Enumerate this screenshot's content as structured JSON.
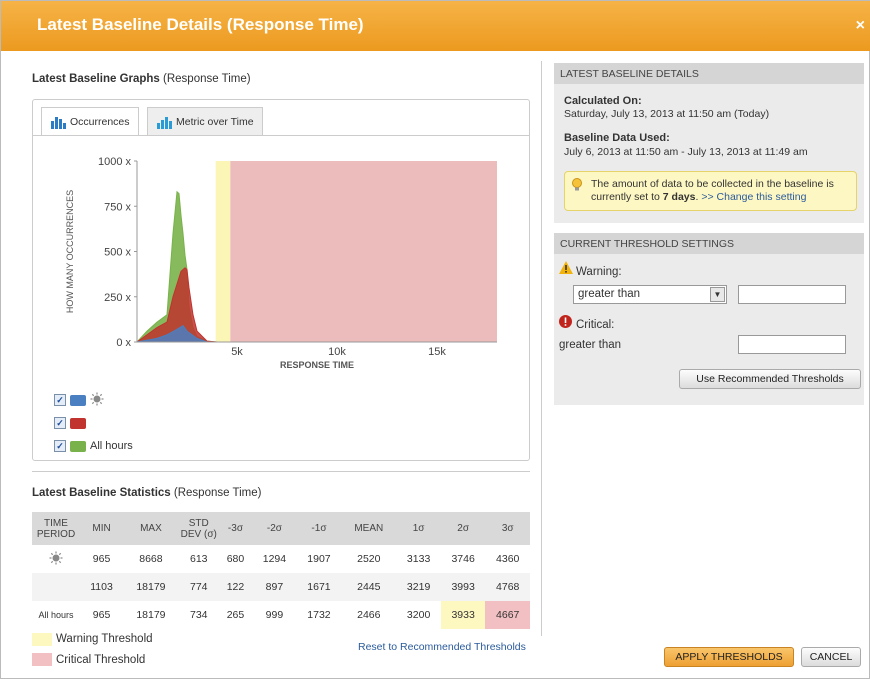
{
  "title": "Latest Baseline Details (Response Time)",
  "close_label": "×",
  "graphs": {
    "heading_bold": "Latest Baseline Graphs",
    "heading_rest": " (Response Time)",
    "tabs": [
      {
        "label": "Occurrences",
        "icon": "bar-chart-icon",
        "active": true
      },
      {
        "label": "Metric over Time",
        "icon": "timeline-chart-icon",
        "active": false
      }
    ],
    "legend": [
      {
        "color": "#4a7fc1",
        "icon": "sun-icon",
        "label": ""
      },
      {
        "color": "#c0332e",
        "icon": "moon-icon",
        "label": ""
      },
      {
        "color": "#79b24a",
        "icon": "",
        "label": "All hours"
      }
    ]
  },
  "chart_data": {
    "type": "area",
    "xlabel": "RESPONSE TIME",
    "ylabel": "HOW MANY OCCURRENCES",
    "y_ticks": [
      "1000 x",
      "750 x",
      "500 x",
      "250 x",
      "0 x"
    ],
    "x_ticks": [
      "5k",
      "10k",
      "15k"
    ],
    "xlim": [
      0,
      18000
    ],
    "ylim": [
      0,
      1000
    ],
    "warning_band": [
      3933,
      4667
    ],
    "critical_band": [
      4667,
      18000
    ],
    "series": [
      {
        "color": "#79b24a",
        "x": [
          0,
          500,
          1000,
          1500,
          1800,
          2000,
          2100,
          2200,
          2300,
          2400,
          2500,
          2600,
          2800,
          3000,
          3500,
          4000
        ],
        "y": [
          0,
          60,
          110,
          150,
          600,
          830,
          820,
          700,
          600,
          480,
          400,
          200,
          80,
          30,
          5,
          0
        ]
      },
      {
        "color": "#c0332e",
        "x": [
          0,
          500,
          1000,
          1500,
          1800,
          2000,
          2200,
          2400,
          2500,
          2600,
          2800,
          3000,
          3500,
          4000
        ],
        "y": [
          0,
          40,
          80,
          110,
          250,
          320,
          390,
          410,
          400,
          300,
          150,
          60,
          5,
          0
        ]
      },
      {
        "color": "#4a7fc1",
        "x": [
          0,
          1000,
          1500,
          2000,
          2300,
          2500,
          3000,
          3500
        ],
        "y": [
          0,
          20,
          40,
          70,
          90,
          60,
          20,
          0
        ]
      }
    ]
  },
  "stats": {
    "heading_bold": "Latest Baseline Statistics",
    "heading_rest": " (Response Time)",
    "columns": [
      "TIME PERIOD",
      "MIN",
      "MAX",
      "STD DEV (σ)",
      "-3σ",
      "-2σ",
      "-1σ",
      "MEAN",
      "1σ",
      "2σ",
      "3σ"
    ],
    "rows": [
      {
        "period": "",
        "icon": "sun-icon",
        "values": [
          "965",
          "8668",
          "613",
          "680",
          "1294",
          "1907",
          "2520",
          "3133",
          "3746",
          "4360"
        ]
      },
      {
        "period": "",
        "icon": "moon-icon",
        "values": [
          "1103",
          "18179",
          "774",
          "122",
          "897",
          "1671",
          "2445",
          "3219",
          "3993",
          "4768"
        ]
      },
      {
        "period": "All hours",
        "icon": "",
        "values": [
          "965",
          "18179",
          "734",
          "265",
          "999",
          "1732",
          "2466",
          "3200",
          "3933",
          "4667"
        ]
      }
    ],
    "warning_key": "Warning Threshold",
    "critical_key": "Critical Threshold",
    "reset_link": "Reset to Recommended Thresholds",
    "warning_color": "#fdf8c0",
    "critical_color": "#f2c0c2"
  },
  "details": {
    "header": "LATEST BASELINE DETAILS",
    "calculated_label": "Calculated On:",
    "calculated_value": "Saturday, July 13, 2013 at 11:50 am (Today)",
    "data_used_label": "Baseline Data Used:",
    "data_used_value": "July 6, 2013 at 11:50 am - July 13, 2013 at 11:49 am",
    "hint_text": "The amount of data to be collected in the baseline is currently set to",
    "hint_days": "7 days",
    "hint_link": ">> Change this setting"
  },
  "thresholds": {
    "header": "CURRENT THRESHOLD SETTINGS",
    "warning_label": "Warning:",
    "warning_select": "greater than",
    "warning_value": "",
    "critical_label": "Critical:",
    "critical_op": "greater than",
    "critical_value": "",
    "recommend_button": "Use Recommended Thresholds"
  },
  "footer": {
    "apply": "APPLY THRESHOLDS",
    "cancel": "CANCEL"
  }
}
